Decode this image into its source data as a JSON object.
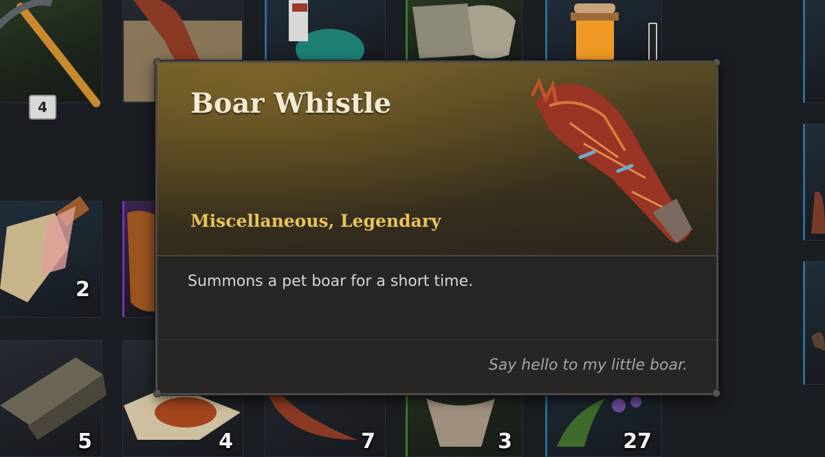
{
  "tooltip": {
    "title": "Boar Whistle",
    "type": "Miscellaneous, Legendary",
    "description": "Summons a pet boar for a short time.",
    "flavor": "Say hello to my little boar.",
    "icon": "boar-horn-icon"
  },
  "inventory": {
    "pickaxe_badge": "4",
    "counts": {
      "potion": "2",
      "wood": "5",
      "meat": "4",
      "horn": "7",
      "pelt": "3",
      "herbs": "27"
    },
    "rarity_colors": {
      "common": "#2c3038",
      "uncommon": "#3f7a2a",
      "rare": "#2b6f9c",
      "epic": "#7a2fc0",
      "legendary": "#e6c35a"
    }
  }
}
